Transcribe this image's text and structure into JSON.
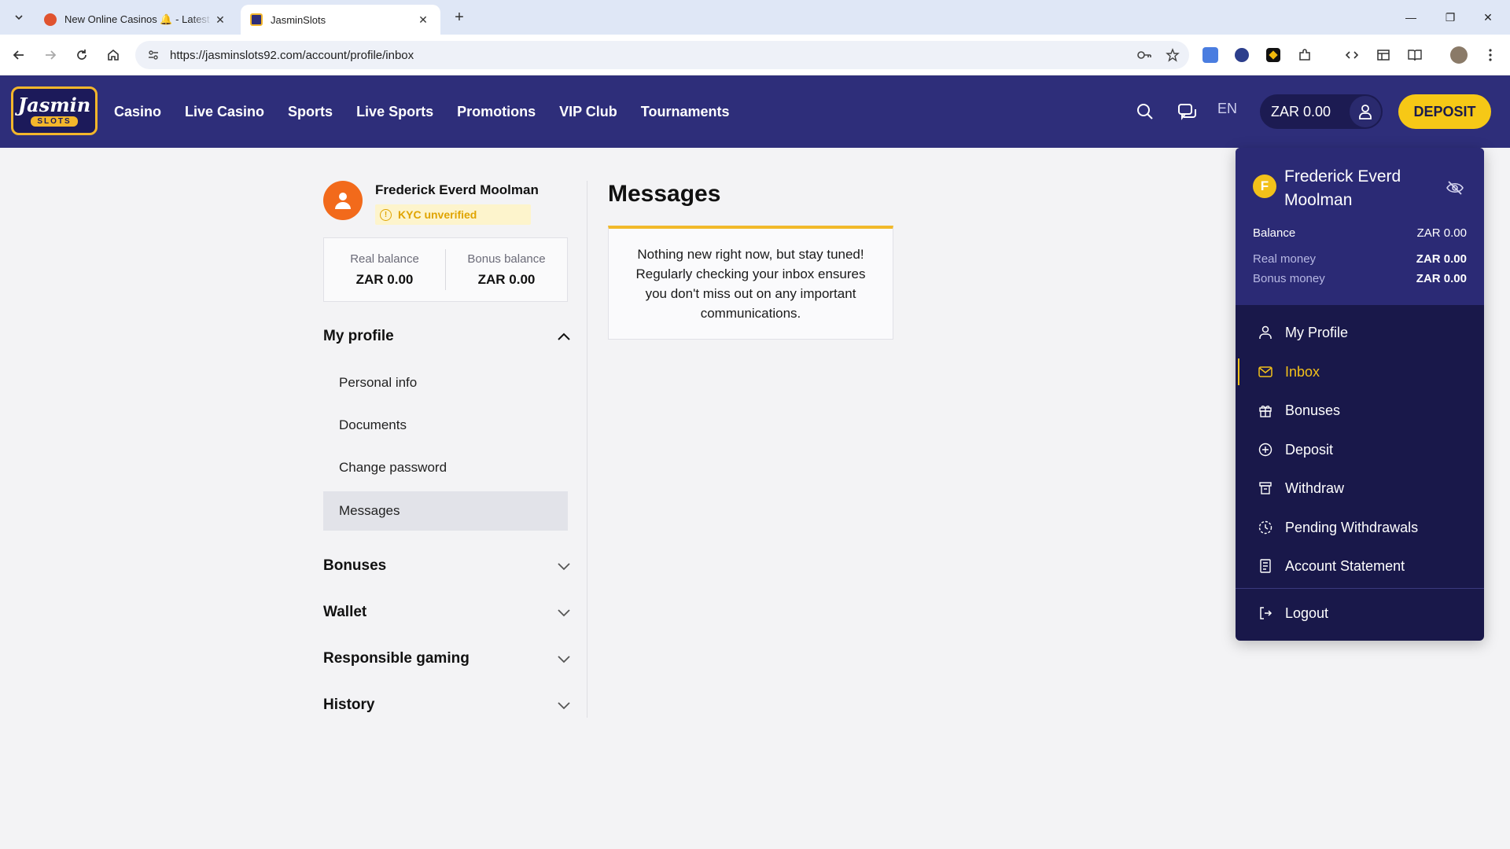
{
  "browser": {
    "tabs": [
      {
        "title": "New Online Casinos 🔔 - Latest",
        "active": false
      },
      {
        "title": "JasminSlots",
        "active": true
      }
    ],
    "url": "https://jasminslots92.com/account/profile/inbox"
  },
  "header": {
    "logo_top": "Jasmin",
    "logo_bottom": "SLOTS",
    "nav": [
      "Casino",
      "Live Casino",
      "Sports",
      "Live Sports",
      "Promotions",
      "VIP Club",
      "Tournaments"
    ],
    "language": "EN",
    "balance": "ZAR 0.00",
    "deposit_label": "DEPOSIT"
  },
  "sidebar": {
    "user_name": "Frederick Everd Moolman",
    "kyc_status": "KYC unverified",
    "real_balance_label": "Real balance",
    "real_balance_value": "ZAR 0.00",
    "bonus_balance_label": "Bonus balance",
    "bonus_balance_value": "ZAR 0.00",
    "sections": [
      {
        "title": "My profile",
        "expanded": true,
        "items": [
          "Personal info",
          "Documents",
          "Change password",
          "Messages"
        ],
        "active_item": "Messages"
      },
      {
        "title": "Bonuses",
        "expanded": false
      },
      {
        "title": "Wallet",
        "expanded": false
      },
      {
        "title": "Responsible gaming",
        "expanded": false
      },
      {
        "title": "History",
        "expanded": false
      }
    ]
  },
  "content": {
    "title": "Messages",
    "empty_message": "Nothing new right now, but stay tuned! Regularly checking your inbox ensures you don't miss out on any important communications."
  },
  "account_menu": {
    "avatar_letter": "F",
    "user_name": "Frederick Everd Moolman",
    "balance_label": "Balance",
    "balance_value": "ZAR 0.00",
    "real_money_label": "Real money",
    "real_money_value": "ZAR 0.00",
    "bonus_money_label": "Bonus money",
    "bonus_money_value": "ZAR 0.00",
    "items": [
      "My Profile",
      "Inbox",
      "Bonuses",
      "Deposit",
      "Withdraw",
      "Pending Withdrawals",
      "Account Statement"
    ],
    "active_item": "Inbox",
    "logout_label": "Logout"
  },
  "colors": {
    "header_bg": "#2e2e7a",
    "accent_yellow": "#f6c816",
    "menu_bg": "#19184a",
    "avatar_orange": "#f26a1b"
  }
}
